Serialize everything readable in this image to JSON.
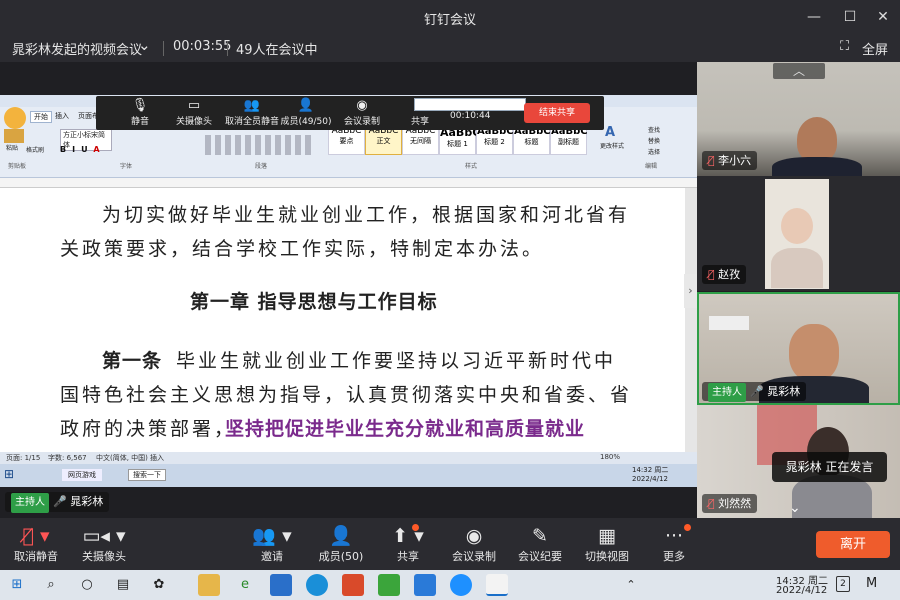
{
  "app": {
    "title": "钉钉会议"
  },
  "window_controls": {
    "minimize": "—",
    "maximize": "☐",
    "close": "✕"
  },
  "info": {
    "meeting_name": "晁彩林发起的视频会议",
    "dropdown": "⌄",
    "duration": "00:03:55",
    "participants": "49人在会议中",
    "fullscreen": "全屏"
  },
  "float_toolbar": {
    "mute": "静音",
    "camera": "关摄像头",
    "mute_all": "取消全员静音",
    "members": "成员(49/50)",
    "record": "会议录制",
    "share": "共享",
    "share_timer": "00:10:44",
    "end_share": "结束共享"
  },
  "word": {
    "tabs": [
      "开始",
      "插入",
      "页面布局"
    ],
    "font_name": "方正小标宋简体",
    "styles": [
      "要点",
      "正文",
      "无间隔",
      "标题 1",
      "标题 2",
      "标题",
      "副标题"
    ],
    "sample": "AaBbC",
    "group_labels": [
      "剪贴板",
      "字体",
      "段落",
      "样式",
      "编辑"
    ],
    "find": "查找",
    "replace": "替换",
    "select": "选择",
    "change_style": "更改样式",
    "paste": "粘贴",
    "format_painter": "格式刷"
  },
  "doc": {
    "lines": [
      "为切实做好毕业生就业创业工作，根据国家和河北省有",
      "关政策要求，结合学校工作实际，特制定本办法。",
      "第一章  指导思想与工作目标",
      "第一条",
      "毕业生就业创业工作要坚持以习近平新时代中",
      "国特色社会主义思想为指导，认真贯彻落实中央和省委、省",
      "政府的决策部署，",
      "坚持把促进毕业生充分就业和高质量就业"
    ]
  },
  "word_status": {
    "page": "页面: 1/15",
    "words": "字数: 6,567",
    "lang": "中文(简体, 中国)",
    "mode": "插入",
    "zoom": "180%"
  },
  "inner_taskbar": {
    "app1": "网页游戏",
    "app2": "搜索一下",
    "time": "14:32 周二",
    "date": "2022/4/12"
  },
  "screen_host": {
    "role": "主持人",
    "name": "晁彩林"
  },
  "tiles": [
    {
      "name": "李小六",
      "muted": true
    },
    {
      "name": "赵孜",
      "muted": true
    },
    {
      "name": "晁彩林",
      "role": "主持人",
      "muted": false
    },
    {
      "name": "刘然然",
      "muted": true
    }
  ],
  "speaking": "晁彩林  正在发言",
  "bottom": {
    "unmute": "取消静音",
    "camera_off": "关摄像头",
    "invite": "邀请",
    "members": "成员(50)",
    "share": "共享",
    "record": "会议录制",
    "minutes": "会议纪要",
    "switch_view": "切换视图",
    "more": "更多",
    "leave": "离开"
  },
  "systray": {
    "time": "14:32 周二",
    "date": "2022/4/12",
    "notif_count": "2"
  },
  "colors": {
    "accent_orange": "#ef5c2c",
    "host_green": "#2e9e47",
    "active_speaker_border": "#2e9e47",
    "doc_purple": "#7a2a8c"
  }
}
